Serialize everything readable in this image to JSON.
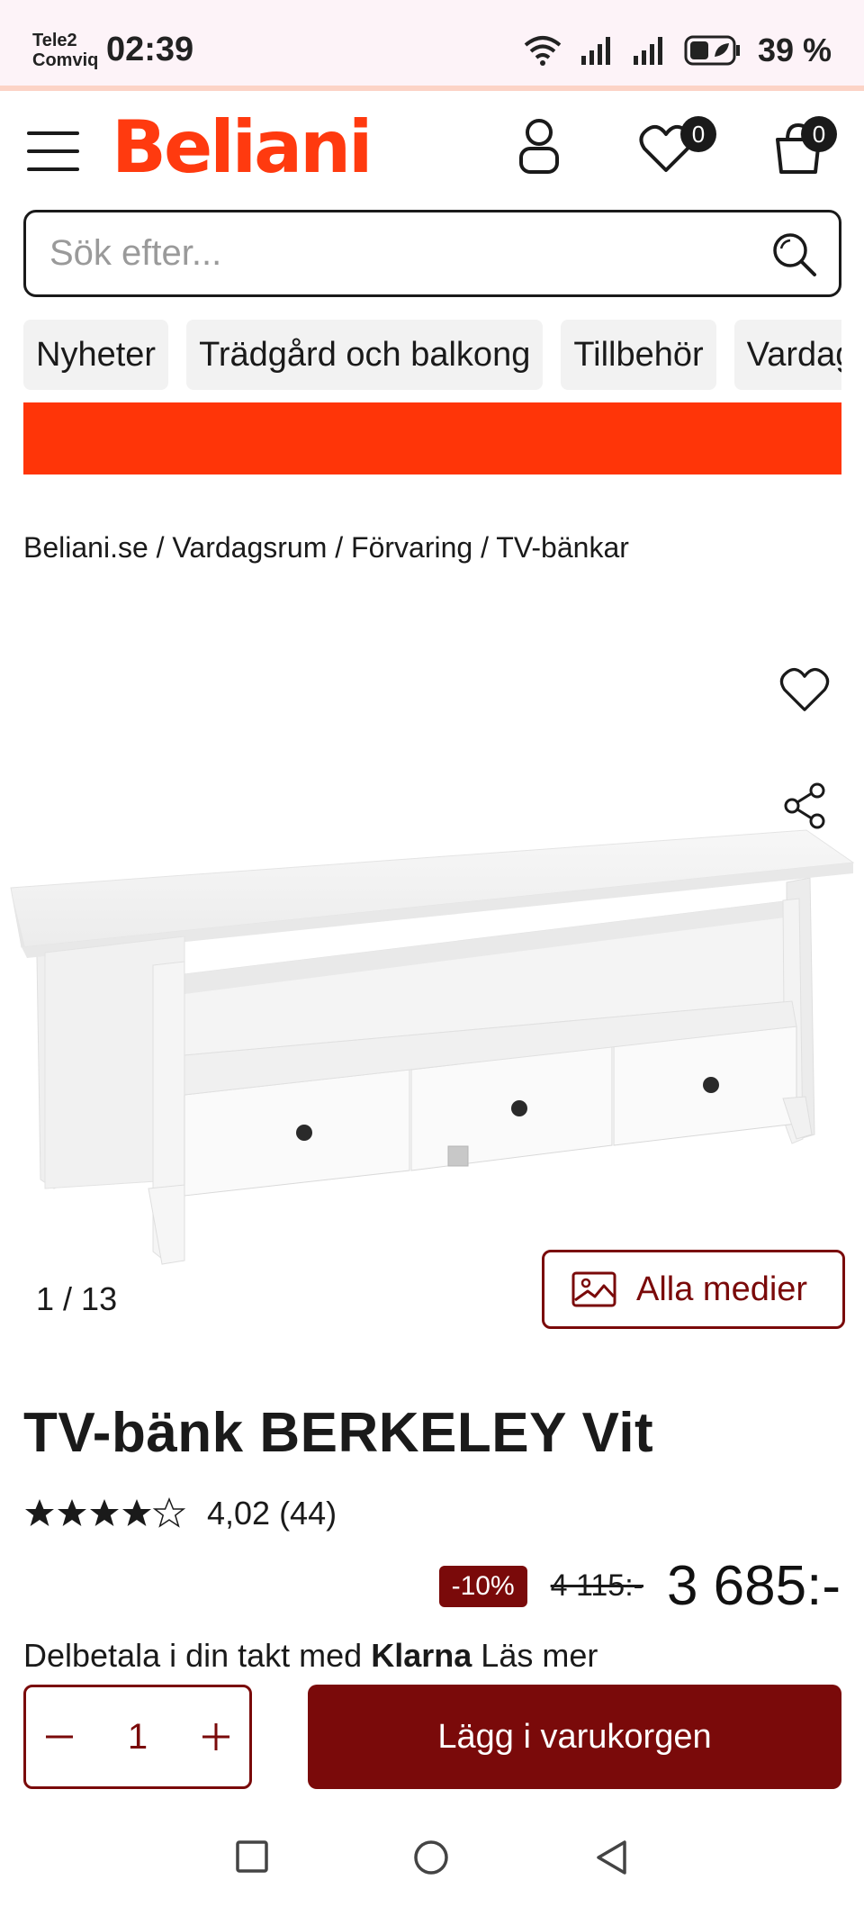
{
  "status_bar": {
    "carrier_line1": "Tele2",
    "carrier_line2": "Comviq",
    "time": "02:39",
    "battery": "39 %"
  },
  "header": {
    "logo": "Beliani",
    "wishlist_count": "0",
    "cart_count": "0"
  },
  "search": {
    "placeholder": "Sök efter..."
  },
  "categories": [
    "Nyheter",
    "Trädgård och balkong",
    "Tillbehör",
    "Vardagsrum"
  ],
  "breadcrumb": [
    "Beliani.se",
    "Vardagsrum",
    "Förvaring",
    "TV-bänkar"
  ],
  "gallery": {
    "current": "1",
    "total": "13",
    "all_media_label": "Alla medier"
  },
  "product": {
    "title": "TV-bänk BERKELEY Vit",
    "rating_value": 4.02,
    "rating_text": "4,02 (44)",
    "discount": "-10%",
    "old_price": "4 115:-",
    "price": "3 685:-",
    "klarna_prefix": "Delbetala i din takt med",
    "klarna_brand": "Klarna",
    "klarna_suffix": "Läs mer"
  },
  "cart": {
    "quantity": "1",
    "add_label": "Lägg i varukorgen"
  },
  "colors": {
    "brand": "#ff3a0f",
    "accent": "#7a0a0a"
  }
}
